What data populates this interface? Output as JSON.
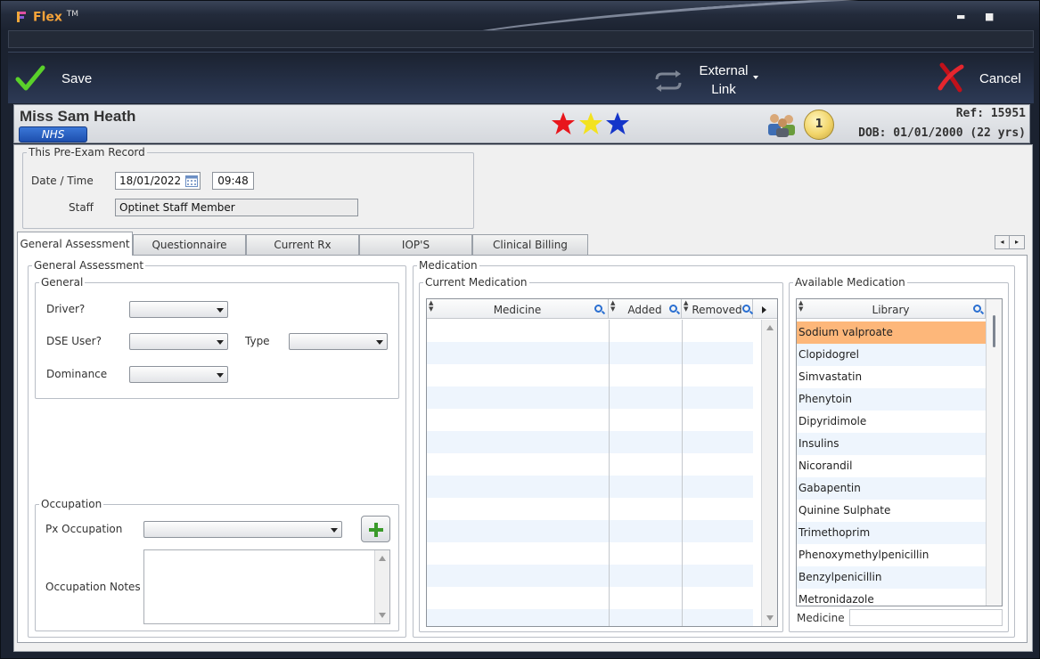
{
  "window": {
    "title": "Flex",
    "trademark": "TM"
  },
  "toolbar": {
    "save_label": "Save",
    "external_link_label": "External\nLink",
    "cancel_label": "Cancel"
  },
  "patient": {
    "name": "Miss Sam Heath",
    "badge": "NHS",
    "ref": "Ref: 15951",
    "dob": "DOB: 01/01/2000 (22 yrs)",
    "notification_count": "1",
    "stars": [
      "#e8161c",
      "#f3e21f",
      "#1435c9"
    ]
  },
  "record": {
    "legend": "This Pre-Exam Record",
    "datetime_label": "Date / Time",
    "date": "18/01/2022",
    "time": "09:48",
    "staff_label": "Staff",
    "staff": "Optinet Staff Member"
  },
  "tabs": [
    "General Assessment",
    "Questionnaire",
    "Current Rx",
    "IOP'S",
    "Clinical Billing"
  ],
  "general_assessment": {
    "legend": "General Assessment",
    "general": {
      "legend": "General",
      "driver_label": "Driver?",
      "dse_label": "DSE User?",
      "type_label": "Type",
      "dominance_label": "Dominance"
    },
    "occupation": {
      "legend": "Occupation",
      "px_occupation_label": "Px Occupation",
      "notes_label": "Occupation Notes"
    }
  },
  "medication": {
    "legend": "Medication",
    "current": {
      "legend": "Current Medication",
      "columns": [
        "Medicine",
        "Added",
        "Removed"
      ]
    },
    "available": {
      "legend": "Available Medication",
      "column": "Library",
      "selected_index": 0,
      "selected_color": "#fdb77a",
      "items": [
        "Sodium valproate",
        "Clopidogrel",
        "Simvastatin",
        "Phenytoin",
        "Dipyridimole",
        "Insulins",
        "Nicorandil",
        "Gabapentin",
        "Quinine Sulphate",
        "Trimethoprim",
        "Phenoxymethylpenicillin",
        "Benzylpenicillin",
        "Metronidazole"
      ],
      "search_label": "Medicine"
    }
  },
  "icons": {
    "save": "checkmark-icon",
    "external_link": "sync-arrows-icon",
    "cancel": "red-x-icon",
    "add": "plus-icon",
    "calendar": "calendar-icon",
    "group": "people-icon",
    "search": "magnifier-icon"
  }
}
